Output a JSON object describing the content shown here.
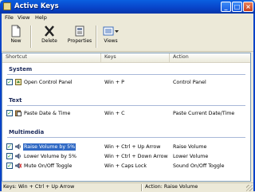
{
  "window": {
    "title": "Active Keys"
  },
  "menu": {
    "file": "File",
    "view": "View",
    "help": "Help"
  },
  "toolbar": {
    "new": "New",
    "delete": "Delete",
    "properties": "Properties",
    "views": "Views"
  },
  "columns": {
    "shortcut": "Shortcut",
    "keys": "Keys",
    "action": "Action"
  },
  "groups": [
    {
      "name": "System",
      "items": [
        {
          "label": "Open Control Panel",
          "keys": "Win + P",
          "action": "Control Panel",
          "checked": true,
          "icon": "control-panel-icon"
        }
      ]
    },
    {
      "name": "Text",
      "items": [
        {
          "label": "Paste Date & Time",
          "keys": "Win + C",
          "action": "Paste Current Date/Time",
          "checked": true,
          "icon": "paste-icon"
        }
      ]
    },
    {
      "name": "Multimedia",
      "items": [
        {
          "label": "Raise Volume by 5%",
          "keys": "Win + Ctrl + Up Arrow",
          "action": "Raise Volume",
          "checked": true,
          "icon": "volume-icon",
          "selected": true
        },
        {
          "label": "Lower Volume by 5%",
          "keys": "Win + Ctrl + Down Arrow",
          "action": "Lower Volume",
          "checked": true,
          "icon": "volume-icon"
        },
        {
          "label": "Mute On/Off Toggle",
          "keys": "Win + Caps Lock",
          "action": "Sound On/Off Toggle",
          "checked": true,
          "icon": "mute-icon"
        }
      ]
    }
  ],
  "status": {
    "keys": "Keys: Win + Ctrl + Up Arrow",
    "action": "Action: Raise Volume"
  },
  "colors": {
    "title_bar": "#0843c8",
    "selection": "#316ac5",
    "check": "#21a121"
  }
}
